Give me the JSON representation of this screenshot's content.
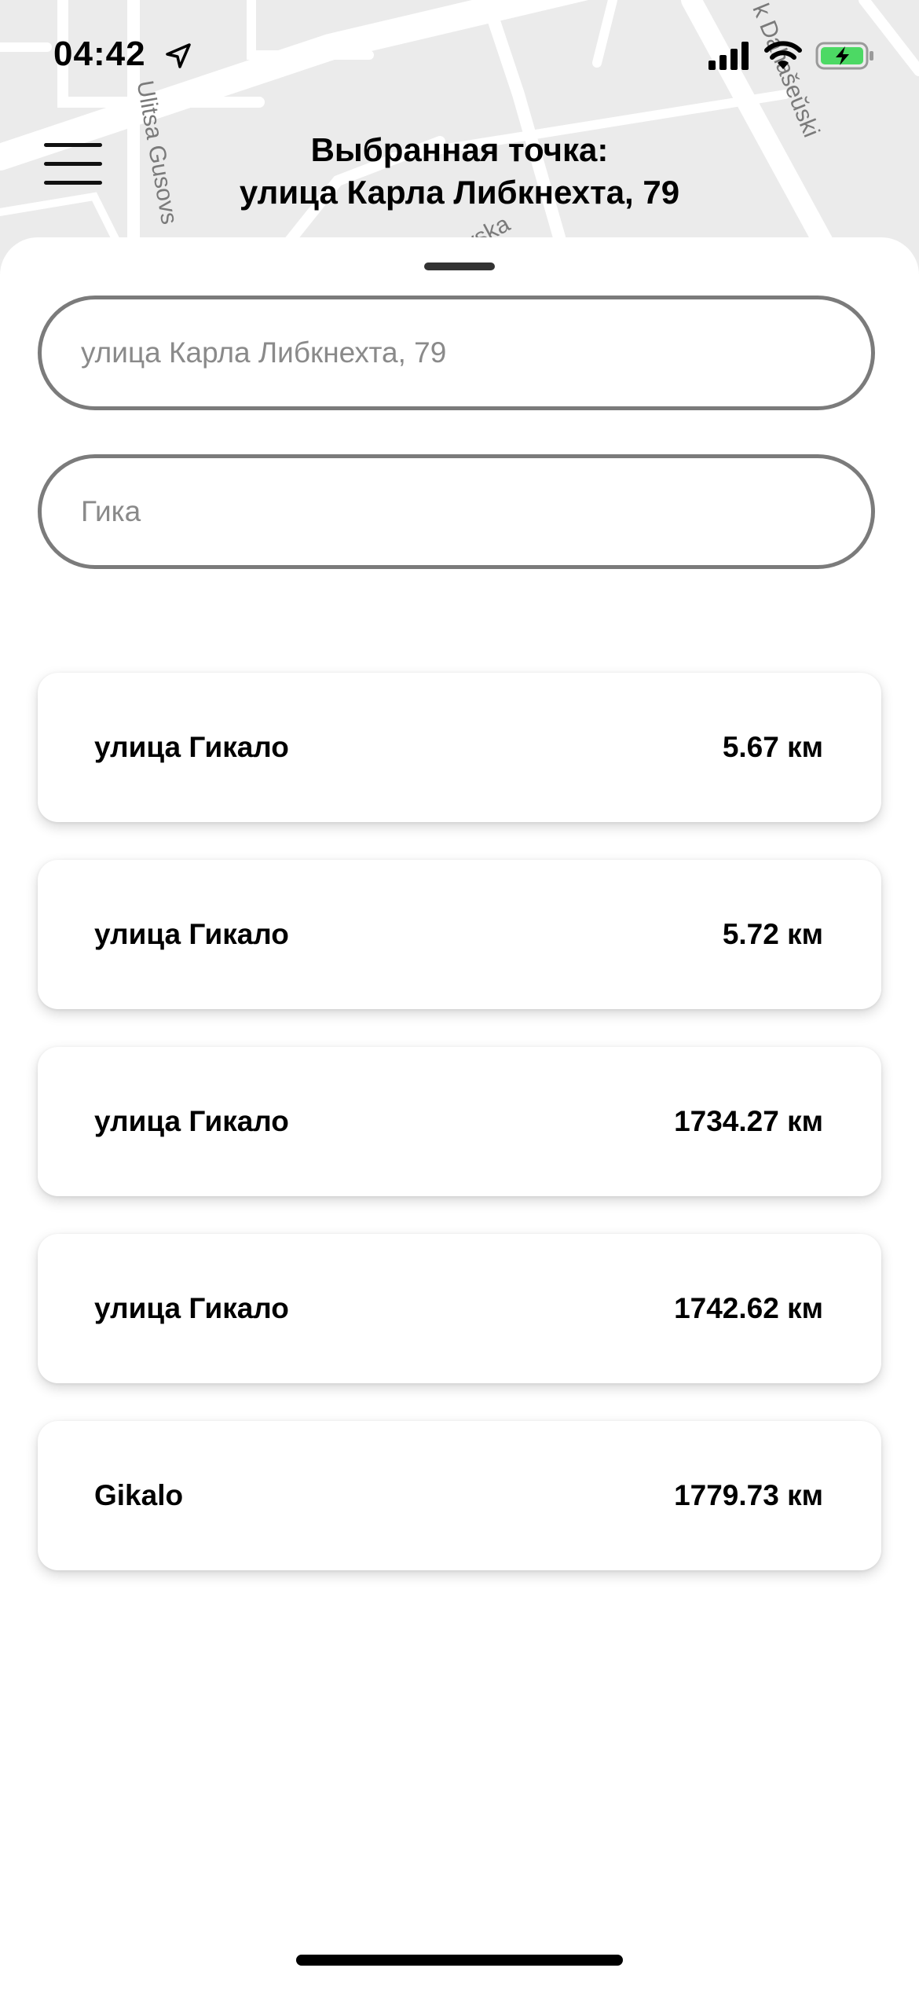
{
  "status_bar": {
    "time": "04:42"
  },
  "map": {
    "street_labels": [
      "Ulitsa Gusovs",
      "ovska",
      "k Dahašeŭski"
    ]
  },
  "header": {
    "title_line1": "Выбранная точка:",
    "title_line2": "улица Карла Либкнехта, 79"
  },
  "search": {
    "from_placeholder": "улица Карла Либкнехта, 79",
    "to_value": "Гика"
  },
  "results": [
    {
      "name": "улица Гикало",
      "distance": "5.67 км"
    },
    {
      "name": "улица Гикало",
      "distance": "5.72 км"
    },
    {
      "name": "улица Гикало",
      "distance": "1734.27 км"
    },
    {
      "name": "улица Гикало",
      "distance": "1742.62 км"
    },
    {
      "name": "Gikalo",
      "distance": "1779.73 км"
    }
  ],
  "colors": {
    "map_background": "#ebebeb",
    "road": "#ffffff",
    "field_border": "#7b7b7b",
    "battery_fill": "#4cd964"
  }
}
